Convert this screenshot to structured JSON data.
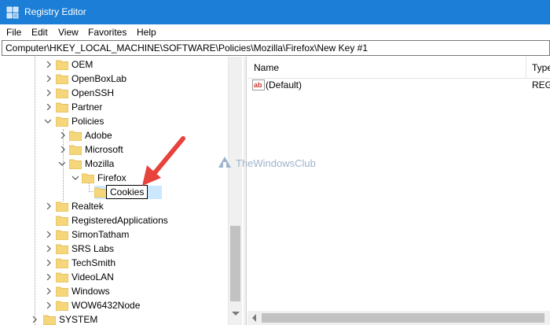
{
  "window": {
    "title": "Registry Editor",
    "accent": "#1c7ed6"
  },
  "menu": {
    "items": [
      "File",
      "Edit",
      "View",
      "Favorites",
      "Help"
    ]
  },
  "address": {
    "path": "Computer\\HKEY_LOCAL_MACHINE\\SOFTWARE\\Policies\\Mozilla\\Firefox\\New Key #1"
  },
  "tree": {
    "nodes": [
      {
        "label": "OEM"
      },
      {
        "label": "OpenBoxLab"
      },
      {
        "label": "OpenSSH"
      },
      {
        "label": "Partner"
      },
      {
        "label": "Policies"
      },
      {
        "label": "Adobe"
      },
      {
        "label": "Microsoft"
      },
      {
        "label": "Mozilla"
      },
      {
        "label": "Firefox"
      },
      {
        "label": "Cookies"
      },
      {
        "label": "Realtek"
      },
      {
        "label": "RegisteredApplications"
      },
      {
        "label": "SimonTatham"
      },
      {
        "label": "SRS Labs"
      },
      {
        "label": "TechSmith"
      },
      {
        "label": "VideoLAN"
      },
      {
        "label": "Windows"
      },
      {
        "label": "WOW6432Node"
      },
      {
        "label": "SYSTEM"
      }
    ]
  },
  "values": {
    "columns": {
      "name": "Name",
      "type": "Type"
    },
    "rows": [
      {
        "name": "(Default)",
        "type": "REG_"
      }
    ]
  },
  "watermark": {
    "text": "TheWindowsClub"
  },
  "annotation": {
    "color": "#e8423c"
  }
}
